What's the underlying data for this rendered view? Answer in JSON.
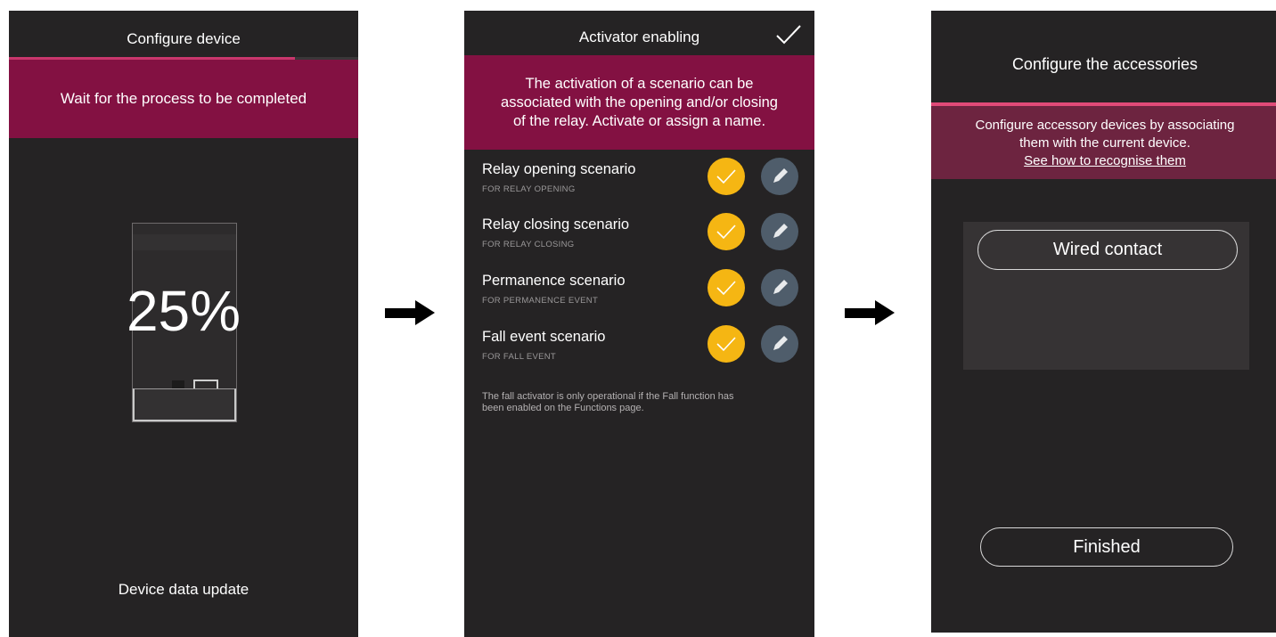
{
  "screen1": {
    "title": "Configure device",
    "banner": "Wait for the process to be completed",
    "progress_percent_text": "25%",
    "progress_fraction": 0.25,
    "footer": "Device data update"
  },
  "screen2": {
    "title": "Activator enabling",
    "banner_line1": "The activation of a scenario can be",
    "banner_line2": "associated with the opening and/or closing",
    "banner_line3": "of the relay. Activate or assign a name.",
    "rows": [
      {
        "title": "Relay opening scenario",
        "subtitle": "FOR RELAY OPENING"
      },
      {
        "title": "Relay closing scenario",
        "subtitle": "FOR RELAY CLOSING"
      },
      {
        "title": "Permanence scenario",
        "subtitle": "FOR PERMANENCE EVENT"
      },
      {
        "title": "Fall event scenario",
        "subtitle": "FOR FALL EVENT"
      }
    ],
    "note_line1": "The fall activator is only operational if the Fall function has",
    "note_line2": "been enabled on the Functions page."
  },
  "screen3": {
    "title": "Configure the accessories",
    "banner_line1": "Configure accessory devices by associating",
    "banner_line2": "them with the current device.",
    "banner_link": "See how to recognise them",
    "wired_button": "Wired contact",
    "finished_button": "Finished"
  },
  "colors": {
    "screen_bg": "#252324",
    "banner": "#831142",
    "accent_yellow": "#f5b613",
    "edit_blue": "#4f5d6b",
    "accent_pink": "#e04a78"
  },
  "icons": [
    "check-icon",
    "pencil-icon",
    "arrow-right-icon"
  ]
}
